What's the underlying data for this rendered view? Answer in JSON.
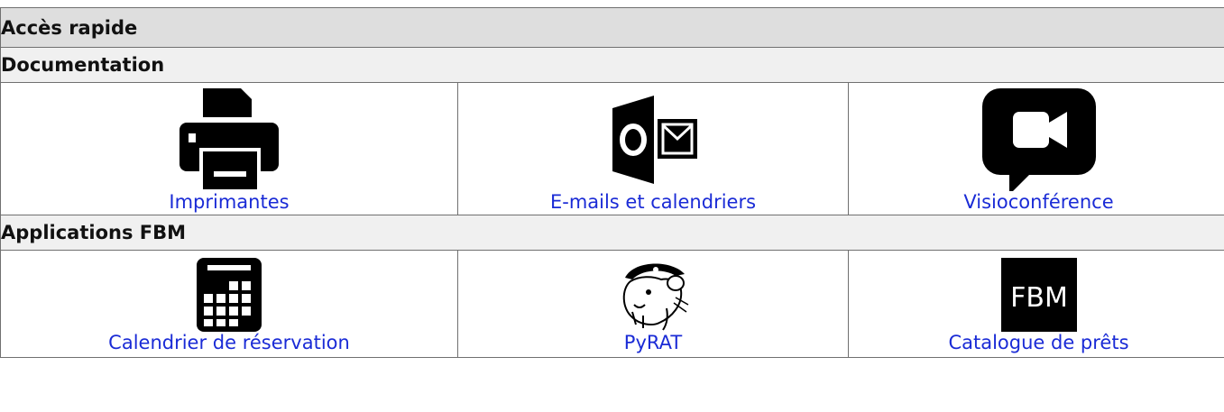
{
  "header": {
    "title": "Accès rapide"
  },
  "sections": [
    {
      "title": "Documentation",
      "items": [
        {
          "label": "Imprimantes",
          "icon": "printer-icon"
        },
        {
          "label": "E-mails et calendriers",
          "icon": "outlook-icon"
        },
        {
          "label": "Visioconférence",
          "icon": "video-chat-icon"
        }
      ]
    },
    {
      "title": "Applications FBM",
      "items": [
        {
          "label": "Calendrier de réservation",
          "icon": "calendar-icon"
        },
        {
          "label": "PyRAT",
          "icon": "pyrat-pirate-mouse-icon"
        },
        {
          "label": "Catalogue de prêts",
          "icon": "fbm-logo-icon",
          "logo_text": "FBM"
        }
      ]
    }
  ],
  "colors": {
    "header_bg": "#dedede",
    "subheader_bg": "#f0f0f0",
    "link": "#1a2bd6",
    "border": "#707070"
  }
}
